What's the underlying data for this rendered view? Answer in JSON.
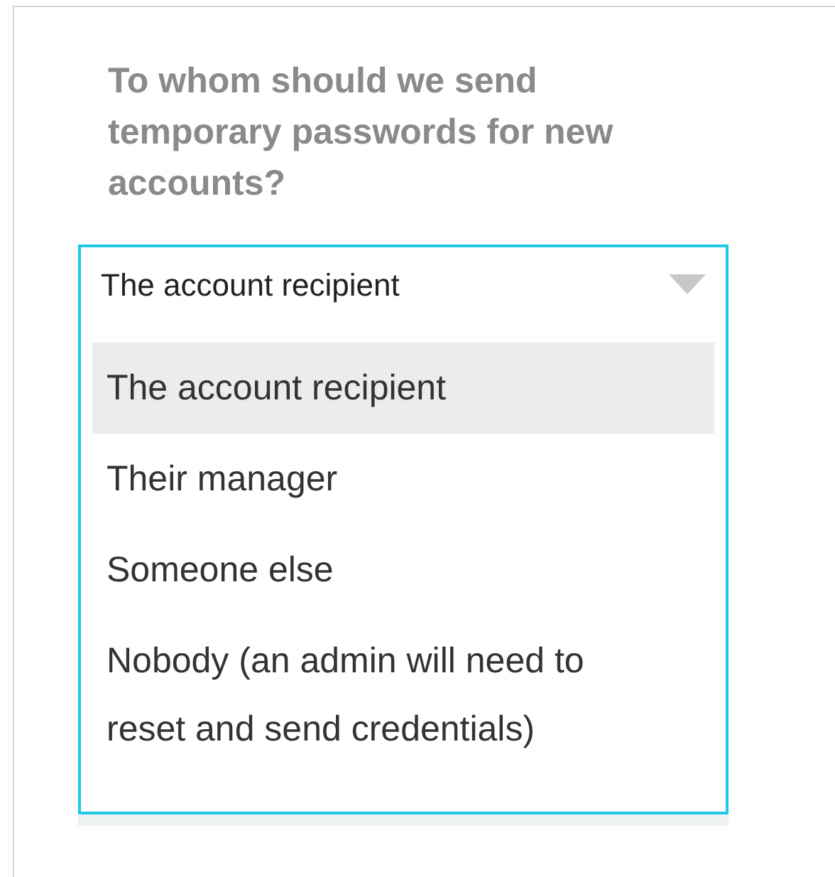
{
  "question": "To whom should we send temporary passwords for new accounts?",
  "dropdown": {
    "value": "The account recipient",
    "expanded": true,
    "options": [
      {
        "label": "The account recipient",
        "selected": true
      },
      {
        "label": "Their manager",
        "selected": false
      },
      {
        "label": "Someone else",
        "selected": false
      },
      {
        "label": "Nobody (an admin will need to reset and send credentials)",
        "selected": false
      }
    ]
  }
}
